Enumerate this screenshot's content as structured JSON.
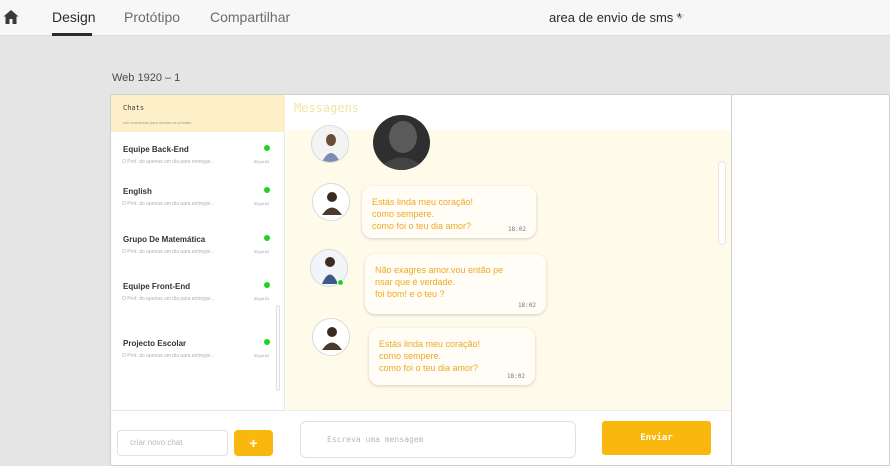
{
  "toolbar": {
    "tabs": [
      {
        "label": "Design"
      },
      {
        "label": "Protótipo"
      },
      {
        "label": "Compartilhar"
      }
    ],
    "document_title": "area de envio de sms *",
    "chevron": "⌵"
  },
  "artboard": {
    "label": "Web 1920 – 1"
  },
  "sidebar": {
    "title": "Chats",
    "subtitle": "crie conversas para manter-se privado",
    "chats": [
      {
        "name": "Equipe Back-End",
        "preview": "O Prof. do apenas um dia para entregar...",
        "time": "20 jul 21",
        "online": true
      },
      {
        "name": "English",
        "preview": "O Prof. do apenas um dia para entregar...",
        "time": "20 jul 21",
        "online": true
      },
      {
        "name": "Grupo De Matemática",
        "preview": "O Prof. do apenas um dia para entregar...",
        "time": "20 jul 21",
        "online": true
      },
      {
        "name": "Equipe Front-End",
        "preview": "O Prof. do apenas um dia para entregar...",
        "time": "20 jul 21",
        "online": true
      },
      {
        "name": "Projecto Escolar",
        "preview": "O Prof. do apenas um dia para entregar...",
        "time": "20 jul 21",
        "online": true
      }
    ],
    "new_chat_placeholder": "criar novo chat",
    "add_label": "+"
  },
  "chat": {
    "title": "Messagens",
    "messages": [
      {
        "text": "Estás linda meu coração!\ncomo sempere.\ncomo foi o teu dia amor?",
        "time": "18:02"
      },
      {
        "text": "Não exagres amor.vou então pe\nnsar que é verdade.\nfoi bom! e o teu ?",
        "time": "18:02"
      },
      {
        "text": "Estás linda meu coração!\ncomo sempere.\ncomo foi o teu dia amor?",
        "time": "18:02"
      }
    ],
    "input_placeholder": "Escreva uma mensagem",
    "send_label": "Enviar"
  },
  "colors": {
    "accent": "#fab70d",
    "online": "#1fd41f",
    "message_text": "#f0a826",
    "chat_background": "#fffbea",
    "sidebar_header": "#fdf0c8"
  },
  "icons": [
    "home-icon",
    "chevron-down-icon"
  ]
}
